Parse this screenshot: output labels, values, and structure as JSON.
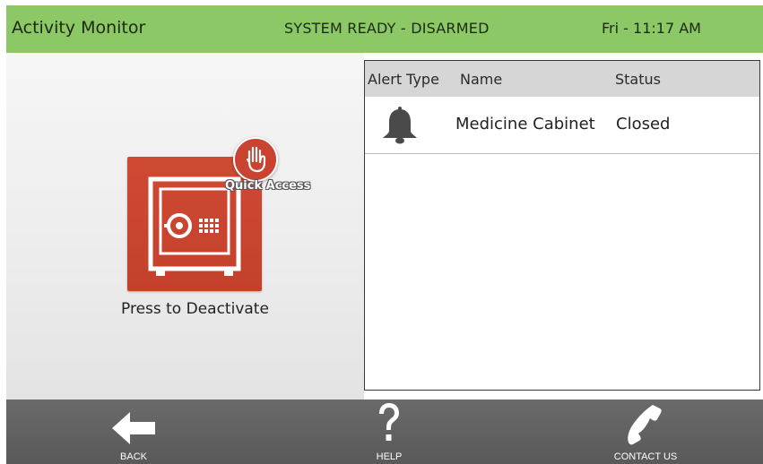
{
  "header": {
    "title": "Activity Monitor",
    "system_status": "SYSTEM READY - DISARMED",
    "clock": "Fri - 11:17 AM"
  },
  "colors": {
    "header_bg": "#8cc865",
    "tile_red": "#c94330",
    "footer_bg": "#5e5e5e"
  },
  "quick_access": {
    "badge_label": "Quick Access",
    "icon": "hand-icon",
    "tile_icon": "safe-icon",
    "action_label": "Press to Deactivate"
  },
  "alerts": {
    "columns": [
      "Alert Type",
      "Name",
      "Status"
    ],
    "rows": [
      {
        "alert_type_icon": "bell-icon",
        "name": "Medicine Cabinet",
        "status": "Closed"
      }
    ]
  },
  "footer": {
    "back": "BACK",
    "help": "HELP",
    "contact": "CONTACT US"
  }
}
